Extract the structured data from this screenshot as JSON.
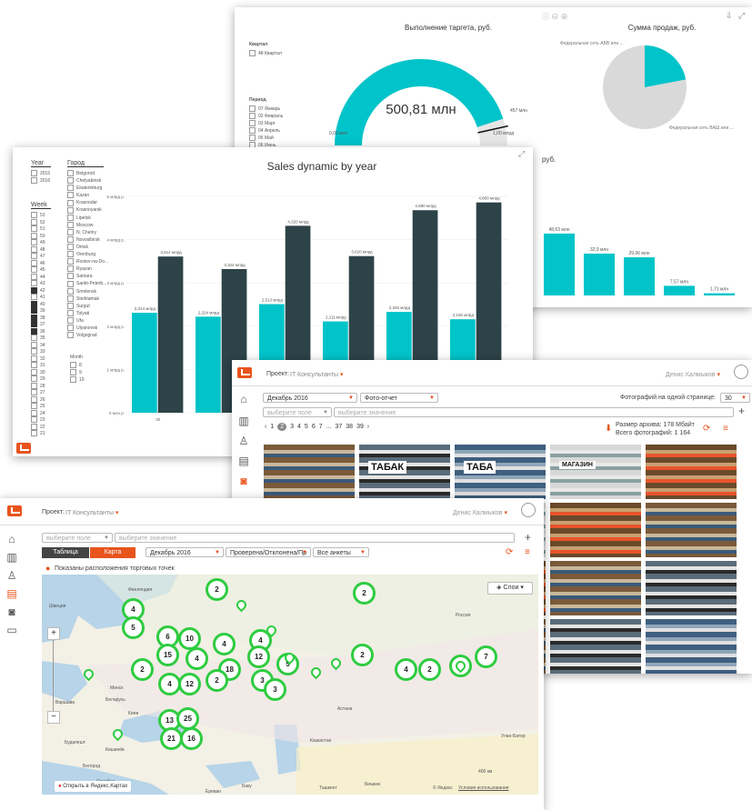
{
  "colors": {
    "teal": "#00c4c9",
    "dark": "#2d4348",
    "orange": "#e8541c",
    "green": "#2ecc40"
  },
  "dash1": {
    "gauge_title": "Выполнение таргета, руб.",
    "gauge_value": "500,81 млн",
    "gauge_min": "0,00 млн",
    "gauge_max": "1,00 млрд",
    "gauge_target": "457 млн",
    "gauge_fraction": 0.9,
    "pie_title": "Сумма продаж, руб.",
    "pie_label1": "Федеральная сеть АБВ или ...",
    "pie_label2": "Федеральная сеть ВАШ или ...",
    "pie_fraction": 0.22,
    "quarter_header": "Квартал",
    "quarter_item": "4й Квартал",
    "period_header": "Период",
    "periods": [
      "07 Январь",
      "02 Февраль",
      "03 Март",
      "04 Апрель",
      "05 Май",
      "06 Июнь"
    ],
    "peek_text": "руб.",
    "bars": [
      {
        "label": "48,63 млн",
        "value": 48.63
      },
      {
        "label": "32,9 млн",
        "value": 32.9
      },
      {
        "label": "29,96 млн",
        "value": 29.96
      },
      {
        "label": "7,57 млн",
        "value": 7.57
      },
      {
        "label": "1,71 млн",
        "value": 1.71
      }
    ]
  },
  "dash2": {
    "year_header": "Year",
    "years": [
      "2015",
      "2016"
    ],
    "week_header": "Week",
    "weeks": [
      "53",
      "52",
      "51",
      "50",
      "49",
      "48",
      "47",
      "46",
      "45",
      "44",
      "43",
      "42",
      "41",
      "40",
      "39",
      "38",
      "37",
      "36",
      "35",
      "34",
      "33",
      "32",
      "31",
      "30",
      "29",
      "28",
      "27",
      "26",
      "25",
      "24",
      "23",
      "22",
      "21"
    ],
    "weeks_checked": [
      "42",
      "40",
      "39",
      "38",
      "37",
      "36"
    ],
    "city_header": "Город",
    "cities": [
      "Belgorod",
      "Chelyabinsk",
      "Ekaterinburg",
      "Kazan",
      "Krasnodar",
      "Krasnoyarsk",
      "Lipetsk",
      "Moscow",
      "N. Chelny",
      "Novosibirsk",
      "Omsk",
      "Orenburg",
      "Rostov-na-Do...",
      "Ryazan",
      "Samara",
      "Sankt-Peterb...",
      "Smolensk",
      "Sterlitamak",
      "Surgut",
      "Tolyati",
      "Ufa",
      "Ulyanovsk",
      "Volgograd"
    ],
    "month_header": "Month",
    "months": [
      "8",
      "9",
      "10"
    ]
  },
  "chart_data": {
    "type": "bar",
    "title": "Sales dynamic by year",
    "categories": [
      "",
      "",
      "",
      "",
      "",
      ""
    ],
    "series": [
      {
        "values": [
          2.31,
          2.22,
          2.51,
          2.11,
          2.33,
          2.16
        ]
      },
      {
        "values": [
          3.61,
          3.32,
          4.32,
          3.62,
          4.68,
          4.86
        ]
      }
    ],
    "value_labels": [
      [
        "2,314 млрд",
        "2,224 млрд",
        "2,513 млрд",
        "2,111 млрд",
        "2,326 млрд",
        "2,160 млрд"
      ],
      [
        "3,614 млрд",
        "3,324 млрд",
        "4,320 млрд",
        "3,620 млрд",
        "4,680 млрд",
        "4,860 млрд"
      ]
    ],
    "ylim": [
      0,
      5
    ],
    "yticks": [
      "0 млн р.",
      "1 млрд р.",
      "2 млрд р.",
      "3 млрд р.",
      "4 млрд р.",
      "5 млрд р."
    ],
    "xlabel_first": "30"
  },
  "dash3": {
    "project_label": "Проект:",
    "project_value": "IT Консультанты",
    "user": "Денис Калмыков",
    "month": "Декабрь 2016",
    "report": "Фото-отчет",
    "per_page_label": "Фотографий на одной странице:",
    "per_page": "30",
    "field_placeholder": "выберите поле",
    "value_placeholder": "выберите значение",
    "pages": [
      "1",
      "2",
      "3",
      "4",
      "5",
      "6",
      "7",
      "...",
      "37",
      "38",
      "39"
    ],
    "archive_size": "Размер архива: 178 Мбайт",
    "total_photos": "Всего фотографий: 1 164",
    "photo_signs": [
      "ТАБАК",
      "ТАБА",
      "МАГАЗИН"
    ]
  },
  "dash4": {
    "project_label": "Проект:",
    "project_value": "IT Консультанты",
    "user": "Денис Калмыков",
    "field_placeholder": "выберите поле",
    "value_placeholder": "выберите значение",
    "tab_table": "Таблица",
    "tab_map": "Карта",
    "month": "Декабрь 2016",
    "status": "Проверена/Отклонена/Пр",
    "surveys": "Все анкеты",
    "shown_text": "Показаны расположения торговых точек",
    "layers": "Слои",
    "open_yandex": "Открыть в Яндекс.Картах",
    "scale": "400 км",
    "copyright": "© Яндекс",
    "terms": "Условия использования",
    "map_labels": [
      "Финляндия",
      "Швеция",
      "Россия",
      "Беларусь",
      "Казахстан",
      "Астана",
      "Улан-Батор",
      "Варшава",
      "Минск",
      "Киев",
      "Будапешт",
      "Кишинёв",
      "Белград",
      "Бишкек",
      "Ташкент",
      "Ереван",
      "Баку",
      "Стамбул"
    ],
    "clusters": [
      "2",
      "2",
      "4",
      "5",
      "6",
      "10",
      "4",
      "4",
      "15",
      "2",
      "4",
      "18",
      "12",
      "5",
      "2",
      "3",
      "4",
      "2",
      "2",
      "7",
      "4",
      "12",
      "2",
      "3",
      "13",
      "25",
      "21",
      "16"
    ]
  }
}
